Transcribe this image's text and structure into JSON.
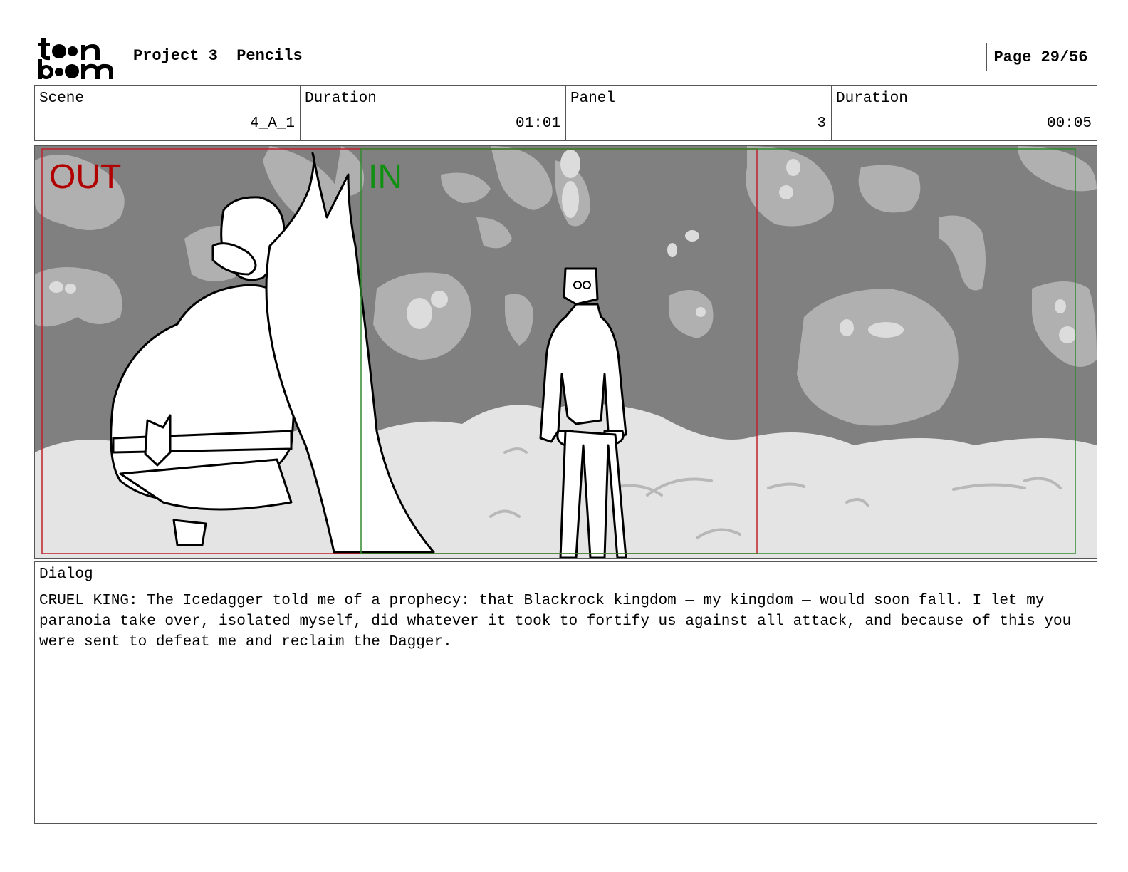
{
  "header": {
    "project_name": "Project 3",
    "stage": "Pencils",
    "page_indicator": "Page 29/56"
  },
  "info": {
    "scene_label": "Scene",
    "scene_value": "4_A_1",
    "scene_duration_label": "Duration",
    "scene_duration_value": "01:01",
    "panel_label": "Panel",
    "panel_value": "3",
    "panel_duration_label": "Duration",
    "panel_duration_value": "00:05"
  },
  "panel": {
    "out_label": "OUT",
    "in_label": "IN",
    "out_color": "#b00000",
    "in_color": "#109010"
  },
  "dialog": {
    "label": "Dialog",
    "text": "CRUEL KING: The Icedagger told me of a prophecy: that Blackrock kingdom — my kingdom — would soon fall. I let my paranoia take over, isolated myself, did whatever it took to fortify us against all attack, and because of this you were sent to defeat me and reclaim the Dagger."
  }
}
